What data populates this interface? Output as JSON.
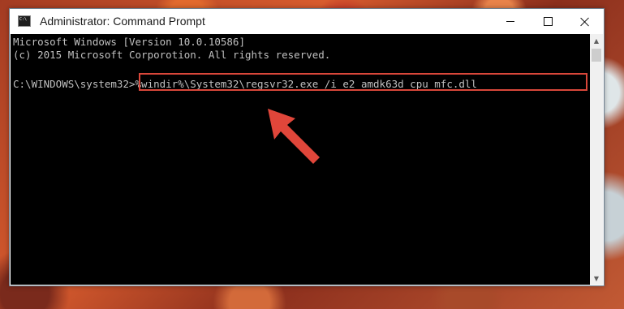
{
  "window": {
    "title": "Administrator: Command Prompt",
    "icon": "cmd-icon"
  },
  "controls": {
    "minimize_icon": "minimize-icon",
    "maximize_icon": "maximize-icon",
    "close_icon": "close-icon"
  },
  "console": {
    "lines": [
      "Microsoft Windows [Version 10.0.10586]",
      "(c) 2015 Microsoft Corporotion. All rights reserved."
    ],
    "prompt": "C:\\WINDOWS\\system32>",
    "command": "%windir%\\System32\\regsvr32.exe /i e2_amdk63d_cpu_mfc.dll"
  },
  "annotation": {
    "highlight_color": "#d9473a",
    "arrow_icon": "red-arrow-icon"
  },
  "colors": {
    "console_bg": "#000000",
    "console_text": "#c0c0c0"
  }
}
